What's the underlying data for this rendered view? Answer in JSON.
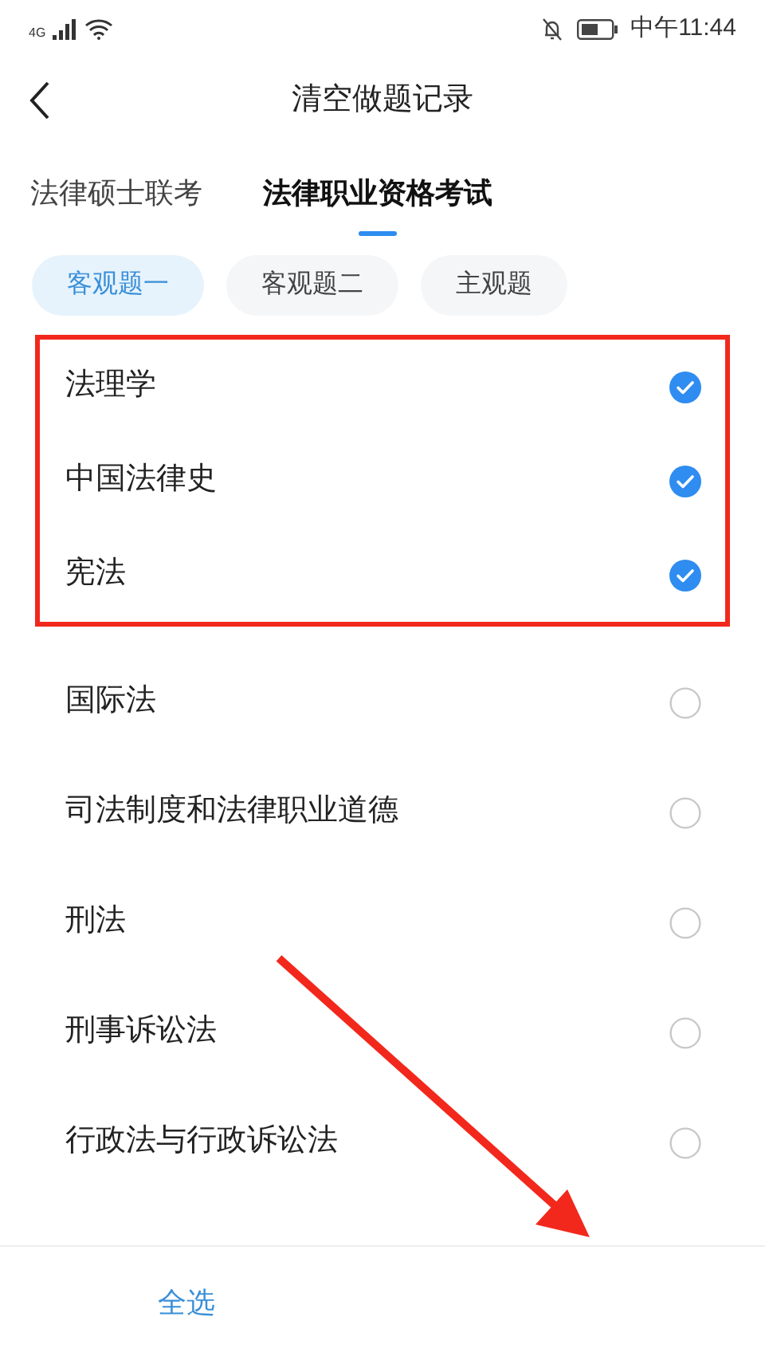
{
  "status_bar": {
    "network": "4G",
    "time": "中午11:44"
  },
  "header": {
    "title": "清空做题记录"
  },
  "tabs": [
    {
      "label": "法律硕士联考",
      "selected": false
    },
    {
      "label": "法律职业资格考试",
      "selected": true
    }
  ],
  "chips": [
    {
      "label": "客观题一",
      "selected": true
    },
    {
      "label": "客观题二",
      "selected": false
    },
    {
      "label": "主观题",
      "selected": false
    }
  ],
  "subjects": [
    {
      "label": "法理学",
      "checked": true
    },
    {
      "label": "中国法律史",
      "checked": true
    },
    {
      "label": "宪法",
      "checked": true
    },
    {
      "label": "国际法",
      "checked": false
    },
    {
      "label": "司法制度和法律职业道德",
      "checked": false
    },
    {
      "label": "刑法",
      "checked": false
    },
    {
      "label": "刑事诉讼法",
      "checked": false
    },
    {
      "label": "行政法与行政诉讼法",
      "checked": false
    }
  ],
  "bottom_bar": {
    "select_all": "全选"
  }
}
